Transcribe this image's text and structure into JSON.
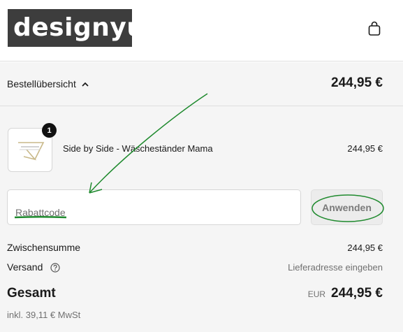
{
  "header": {
    "logo_text": "designyu.",
    "cart_icon": "shopping-bag-icon"
  },
  "summary": {
    "toggle_label": "Bestellübersicht",
    "toggle_icon": "chevron-up-icon",
    "toggle_total": "244,95 €"
  },
  "cart": {
    "items": [
      {
        "quantity": "1",
        "name": "Side by Side - Wäscheständer Mama",
        "price": "244,95 €"
      }
    ]
  },
  "discount": {
    "placeholder": "Rabattcode",
    "apply_label": "Anwenden"
  },
  "totals": {
    "subtotal_label": "Zwischensumme",
    "subtotal_value": "244,95 €",
    "shipping_label": "Versand",
    "shipping_value": "Lieferadresse eingeben",
    "total_label": "Gesamt",
    "currency": "EUR",
    "total_value": "244,95 €",
    "tax_note": "inkl. 39,11 € MwSt"
  },
  "colors": {
    "annotation": "#1f8a2e",
    "summary_background": "#f5f5f5",
    "logo_background": "#3d3d3d"
  }
}
